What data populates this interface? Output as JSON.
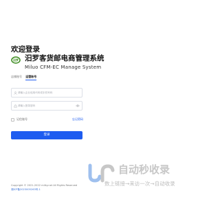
{
  "login": {
    "welcome": "欢迎登录",
    "brand_title": "汨罗客货邮电商管理系统",
    "brand_subtitle": "Miluo CFM-EC Manage System",
    "logo_text": "汨罗",
    "tabs": [
      {
        "label": "店铺账号",
        "active": false
      },
      {
        "label": "运营账号",
        "active": true
      }
    ],
    "username_placeholder": "请输入企业信用代码或手机号码",
    "password_placeholder": "请输入登录密码",
    "remember_label": "记住账号",
    "remember_checked": false,
    "forgot_label": "忘记密码",
    "login_button": "登录"
  },
  "footer": {
    "copyright": "Copyright © 2021-2022 milky.net All Rights Reserved",
    "icp": "湘ICP备2023005263号-1"
  },
  "watermark": {
    "text": "自动秒收录",
    "subtitle": "数上链接→来访一次→自动收录"
  },
  "colors": {
    "accent": "#1e5cf0",
    "logo_green": "#3a8a1c",
    "watermark_gray": "#c7c7c7",
    "watermark_blue": "#9fc0ee"
  }
}
